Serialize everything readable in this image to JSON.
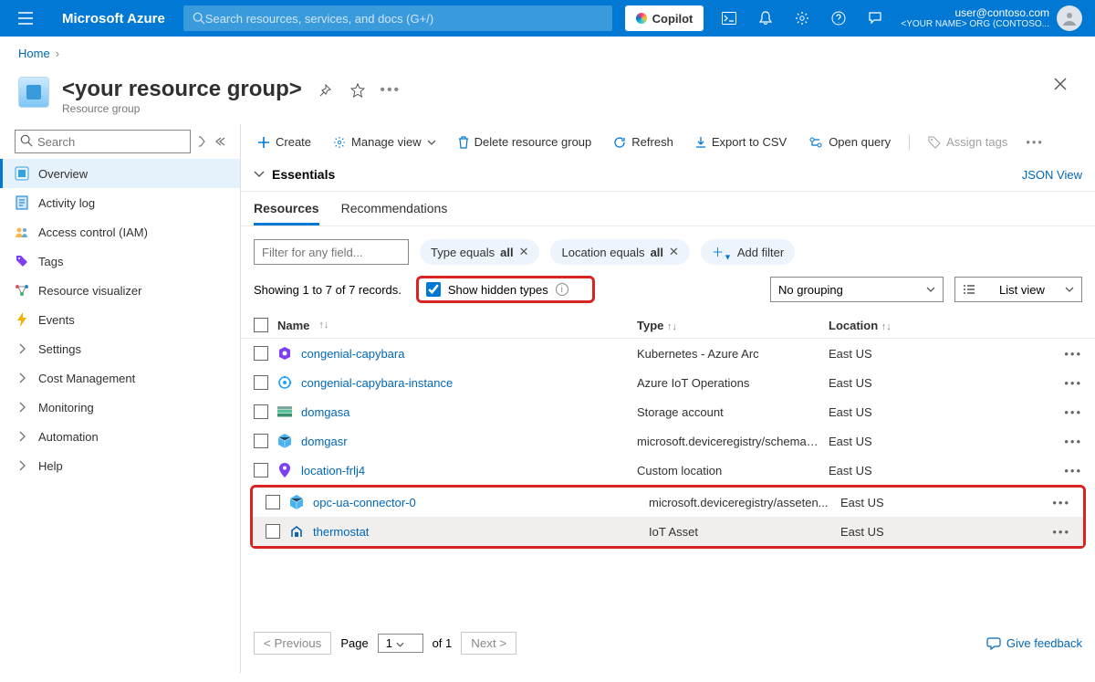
{
  "header": {
    "brand": "Microsoft Azure",
    "search_placeholder": "Search resources, services, and docs (G+/)",
    "copilot": "Copilot",
    "user_email": "user@contoso.com",
    "org_name": "<YOUR NAME> ORG (CONTOSO..."
  },
  "breadcrumb": {
    "home": "Home"
  },
  "page": {
    "title": "<your resource group>",
    "subtitle": "Resource group"
  },
  "sidebar": {
    "search_placeholder": "Search",
    "items": [
      {
        "label": "Overview",
        "icon": "overview-icon",
        "active": true
      },
      {
        "label": "Activity log",
        "icon": "activity-log-icon"
      },
      {
        "label": "Access control (IAM)",
        "icon": "access-control-icon"
      },
      {
        "label": "Tags",
        "icon": "tags-icon"
      },
      {
        "label": "Resource visualizer",
        "icon": "visualizer-icon"
      },
      {
        "label": "Events",
        "icon": "events-icon"
      },
      {
        "label": "Settings",
        "icon": "chevron-right-icon"
      },
      {
        "label": "Cost Management",
        "icon": "chevron-right-icon"
      },
      {
        "label": "Monitoring",
        "icon": "chevron-right-icon"
      },
      {
        "label": "Automation",
        "icon": "chevron-right-icon"
      },
      {
        "label": "Help",
        "icon": "chevron-right-icon"
      }
    ]
  },
  "toolbar": {
    "create": "Create",
    "manage_view": "Manage view",
    "delete": "Delete resource group",
    "refresh": "Refresh",
    "export": "Export to CSV",
    "open_query": "Open query",
    "assign_tags": "Assign tags"
  },
  "essentials": {
    "label": "Essentials",
    "json_view": "JSON View"
  },
  "tabs": {
    "resources": "Resources",
    "recommendations": "Recommendations"
  },
  "filters": {
    "placeholder": "Filter for any field...",
    "type_prefix": "Type equals ",
    "type_value": "all",
    "location_prefix": "Location equals ",
    "location_value": "all",
    "add_filter": "Add filter"
  },
  "count": {
    "text": "Showing 1 to 7 of 7 records.",
    "show_hidden": "Show hidden types"
  },
  "viewopts": {
    "grouping": "No grouping",
    "list_view": "List view"
  },
  "columns": {
    "name": "Name",
    "type": "Type",
    "location": "Location"
  },
  "rows": [
    {
      "name": "congenial-capybara",
      "type": "Kubernetes - Azure Arc",
      "location": "East US",
      "icon": "k8s-arc-icon",
      "color": "#7e3ff2"
    },
    {
      "name": "congenial-capybara-instance",
      "type": "Azure IoT Operations",
      "location": "East US",
      "icon": "iot-ops-icon",
      "color": "#1fa2ff"
    },
    {
      "name": "domgasa",
      "type": "Storage account",
      "location": "East US",
      "icon": "storage-icon",
      "color": "#47c28b"
    },
    {
      "name": "domgasr",
      "type": "microsoft.deviceregistry/schemar...",
      "location": "East US",
      "icon": "cube-icon",
      "color": "#49b3ef"
    },
    {
      "name": "location-frlj4",
      "type": "Custom location",
      "location": "East US",
      "icon": "location-icon",
      "color": "#7e3ff2"
    },
    {
      "name": "opc-ua-connector-0",
      "type": "microsoft.deviceregistry/asseten...",
      "location": "East US",
      "icon": "cube-icon",
      "color": "#49b3ef"
    },
    {
      "name": "thermostat",
      "type": "IoT Asset",
      "location": "East US",
      "icon": "iot-asset-icon",
      "color": "#0b63b2"
    }
  ],
  "pager": {
    "previous": "< Previous",
    "page_label": "Page",
    "page_value": "1",
    "of_text": "of 1",
    "next": "Next >",
    "feedback": "Give feedback"
  }
}
